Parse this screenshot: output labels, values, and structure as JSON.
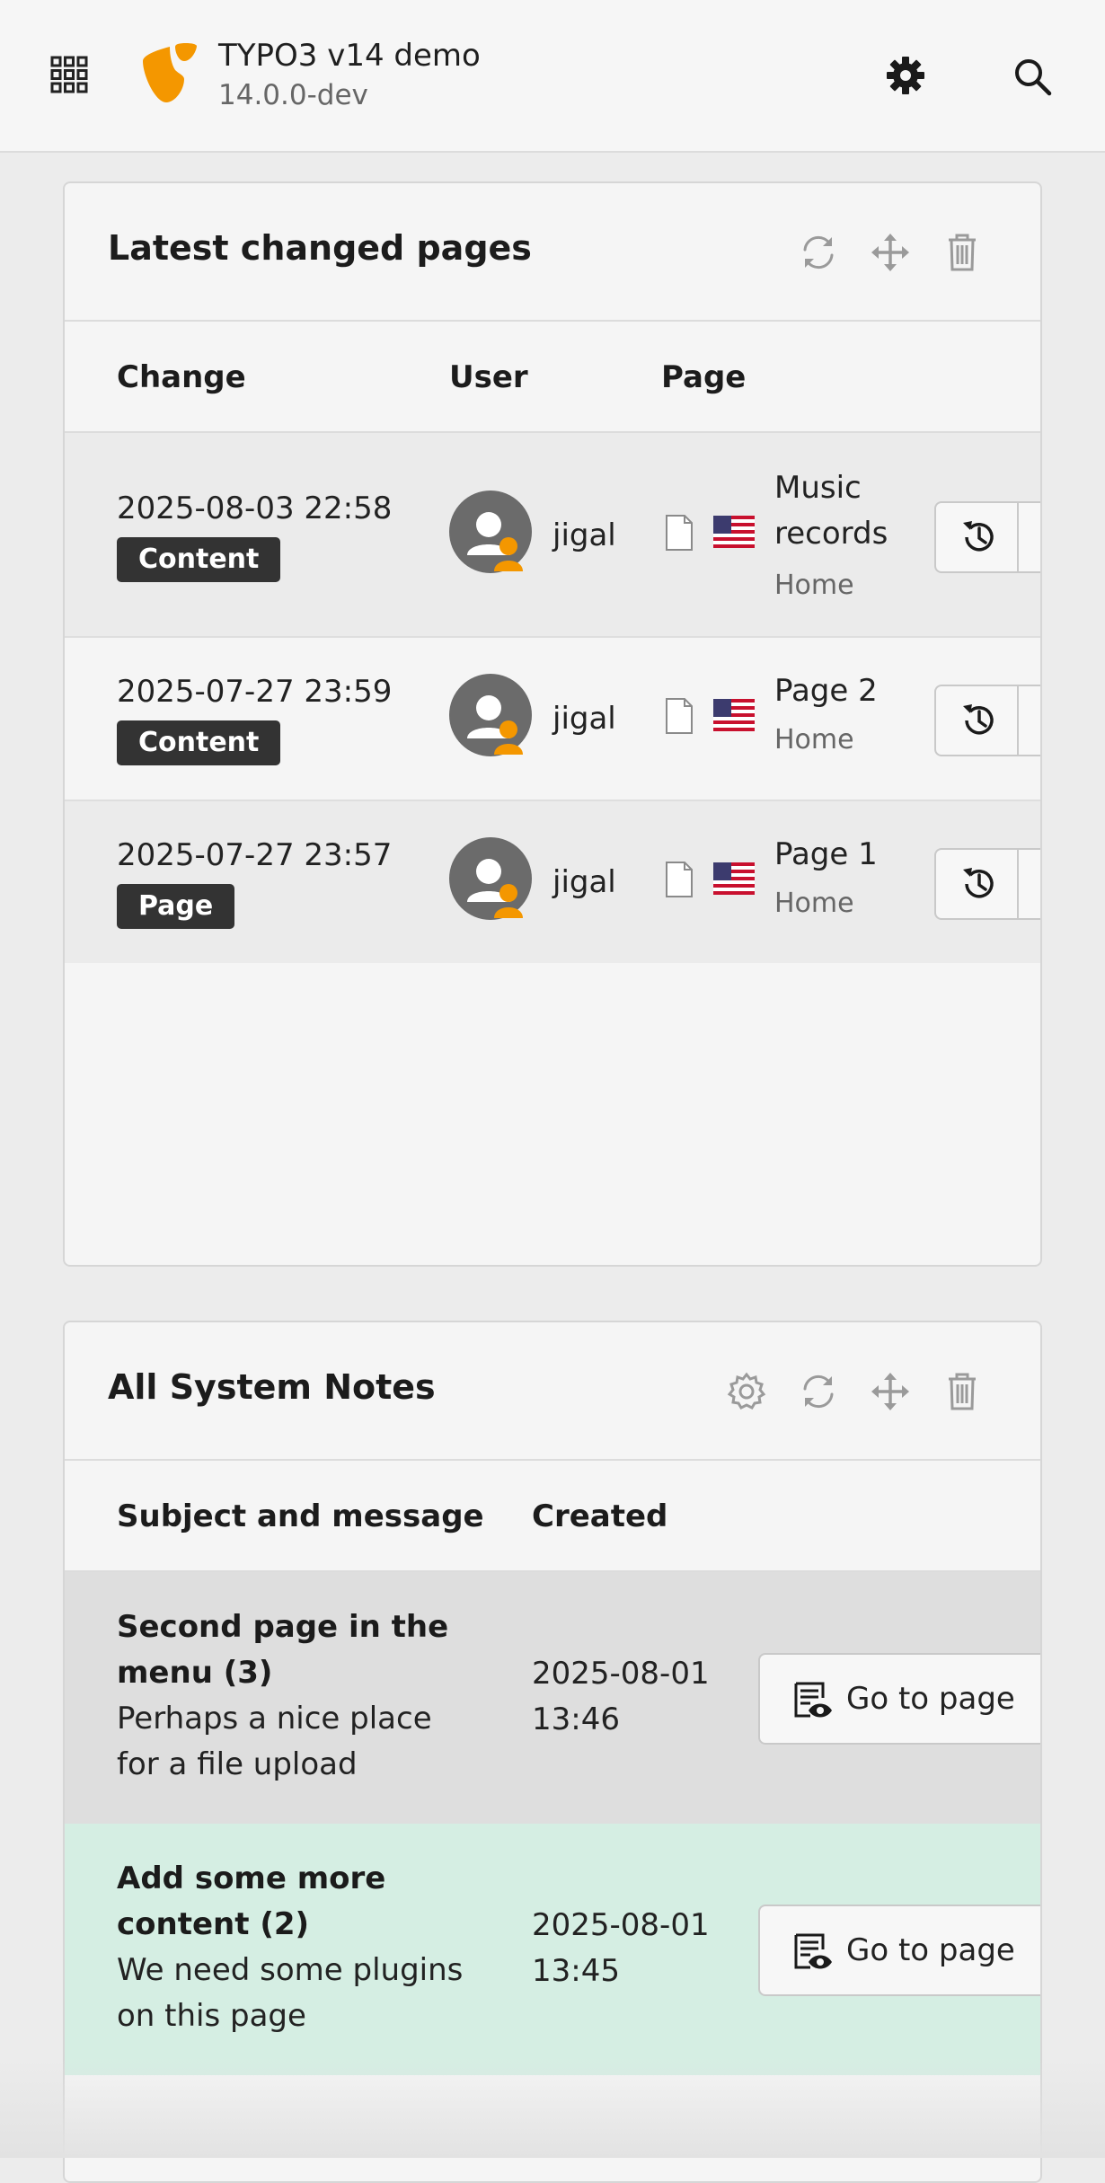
{
  "header": {
    "title": "TYPO3 v14 demo",
    "version": "14.0.0-dev",
    "menu_icon": "grid-icon",
    "logo": "typo3-logo",
    "settings_icon": "gear-icon",
    "search_icon": "search-icon"
  },
  "latest_changed": {
    "title": "Latest changed pages",
    "tools": [
      "refresh-icon",
      "move-icon",
      "trash-icon"
    ],
    "columns": {
      "change": "Change",
      "user": "User",
      "page": "Page"
    },
    "rows": [
      {
        "date": "2025-08-03 22:58",
        "type": "Content",
        "user": "jigal",
        "page_line1": "Music",
        "page_line2": "records",
        "parent": "Home"
      },
      {
        "date": "2025-07-27 23:59",
        "type": "Content",
        "user": "jigal",
        "page_line1": "Page 2",
        "parent": "Home"
      },
      {
        "date": "2025-07-27 23:57",
        "type": "Page",
        "user": "jigal",
        "page_line1": "Page 1",
        "parent": "Home"
      }
    ]
  },
  "system_notes": {
    "title": "All System Notes",
    "tools": [
      "gear-icon",
      "refresh-icon",
      "move-icon",
      "trash-icon"
    ],
    "columns": {
      "subject": "Subject and message",
      "created": "Created"
    },
    "rows": [
      {
        "subject_line1": "Second page in the",
        "subject_line2": "menu (3)",
        "msg_line1": "Perhaps a nice place",
        "msg_line2": "for a file upload",
        "date": "2025-08-01",
        "time": "13:46",
        "button": "Go to page"
      },
      {
        "subject_line1": "Add some more",
        "subject_line2": "content (2)",
        "msg_line1": "We need some plugins",
        "msg_line2": "on this page",
        "date": "2025-08-01",
        "time": "13:45",
        "button": "Go to page"
      }
    ]
  },
  "colors": {
    "brand_orange": "#f49700",
    "badge_bg": "#333333",
    "note_green": "#d5eee3",
    "note_gray": "#dedede"
  }
}
